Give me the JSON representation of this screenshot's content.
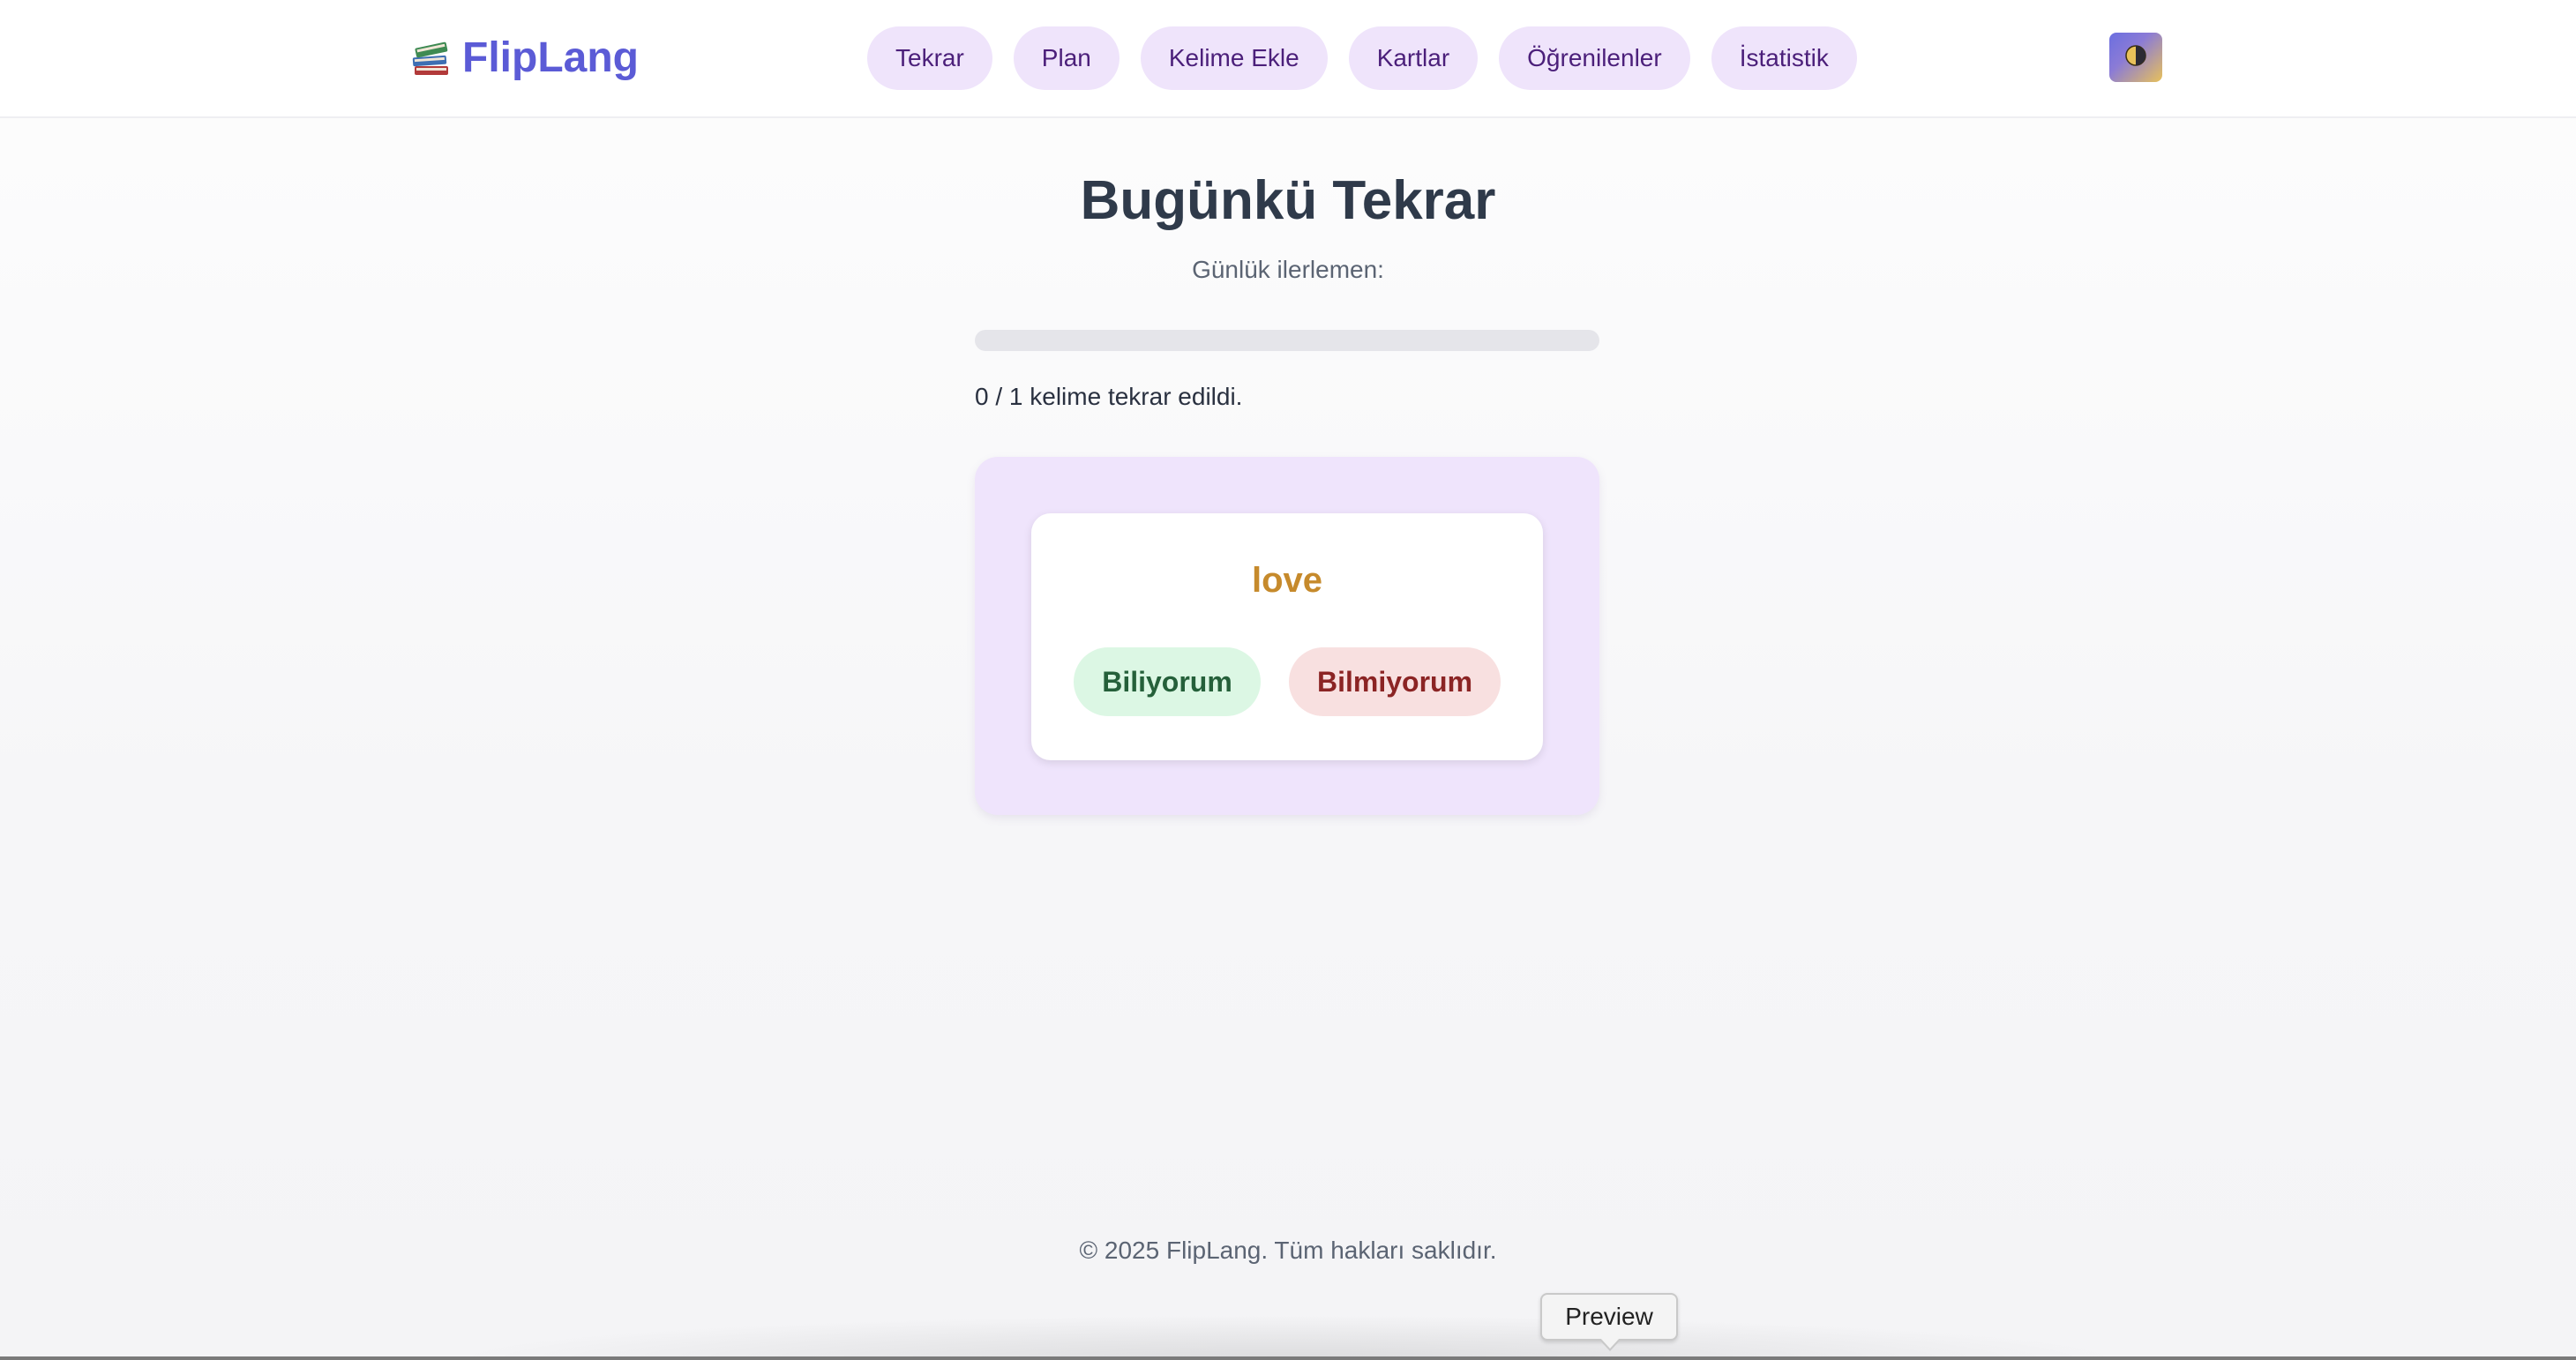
{
  "header": {
    "brand": {
      "icon": "books-icon",
      "name": "FlipLang",
      "color": "#5b5bd6"
    },
    "nav": [
      {
        "label": "Tekrar"
      },
      {
        "label": "Plan"
      },
      {
        "label": "Kelime Ekle"
      },
      {
        "label": "Kartlar"
      },
      {
        "label": "Öğrenilenler"
      },
      {
        "label": "İstatistik"
      }
    ],
    "theme_toggle": {
      "icon": "half-moon-icon"
    }
  },
  "main": {
    "title": "Bugünkü Tekrar",
    "subtitle": "Günlük ilerlemen:",
    "progress": {
      "value": 0,
      "total": 1,
      "fraction": 0.0,
      "text": "0 / 1 kelime tekrar edildi."
    },
    "card": {
      "word": "love",
      "know_label": "Biliyorum",
      "dont_know_label": "Bilmiyorum"
    }
  },
  "footer": {
    "text": "© 2025 FlipLang. Tüm hakları saklıdır."
  },
  "tooltip": {
    "text": "Preview"
  },
  "colors": {
    "accent": "#5b5bd6",
    "nav_bg": "#efe4fb",
    "nav_text": "#4b1f7a",
    "word": "#c68a2c",
    "know_bg": "#dcf7e4",
    "know_text": "#25603a",
    "dont_know_bg": "#f8e0e0",
    "dont_know_text": "#8b2424"
  }
}
